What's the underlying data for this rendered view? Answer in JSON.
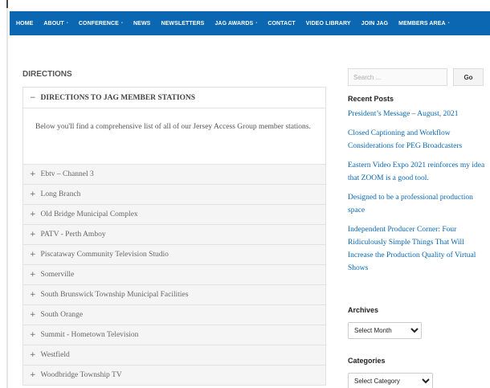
{
  "nav": {
    "items": [
      {
        "label": "HOME",
        "has_dropdown": false
      },
      {
        "label": "ABOUT",
        "has_dropdown": true,
        "active": true
      },
      {
        "label": "CONFERENCE",
        "has_dropdown": true
      },
      {
        "label": "NEWS",
        "has_dropdown": false
      },
      {
        "label": "NEWSLETTERS",
        "has_dropdown": false
      },
      {
        "label": "JAG AWARDS",
        "has_dropdown": true
      },
      {
        "label": "CONTACT",
        "has_dropdown": false
      },
      {
        "label": "VIDEO LIBRARY",
        "has_dropdown": false
      },
      {
        "label": "JOIN JAG",
        "has_dropdown": false
      },
      {
        "label": "MEMBERS AREA",
        "has_dropdown": true
      }
    ],
    "caret": "-"
  },
  "page": {
    "title": "DIRECTIONS"
  },
  "accordion": {
    "open_section": {
      "sign": "−",
      "title": "DIRECTIONS TO JAG MEMBER STATIONS",
      "body": "Below you'll find a comprehensive list of all of our Jersey Access Group member stations."
    },
    "collapsed_sign": "+",
    "items": [
      "Ebtv – Channel 3",
      "Long Branch",
      "Old Bridge Municipal Complex",
      "PATV - Perth Amboy",
      "Piscataway Community Television Studio",
      "Somerville",
      "South Brunswick Township Municipal Facilities",
      "South Orange",
      "Summit - Hometown Television",
      "Westfield",
      "Woodbridge Township TV"
    ]
  },
  "sidebar": {
    "search": {
      "placeholder": "Search ...",
      "button": "Go"
    },
    "recent_posts": {
      "title": "Recent Posts",
      "posts": [
        "President’s Message – August, 2021",
        "Closed Captioning and Workflow Considerations for PEG Broadcasters",
        "Eastern Video Expo 2021 reinforces my idea that ZOOM is a good tool.",
        "Designed to be a professional production space",
        "Independent Producer Corner: Four Ridiculously Simple Things That Will Increase the Production Quality of Virtual Shows"
      ]
    },
    "archives": {
      "title": "Archives",
      "selected": "Select Month"
    },
    "categories": {
      "title": "Categories",
      "selected": "Select Category"
    }
  },
  "colors": {
    "nav_background": "#0b67b2",
    "link": "#0b67b2",
    "collapsed_row": "#f5f5f5"
  }
}
